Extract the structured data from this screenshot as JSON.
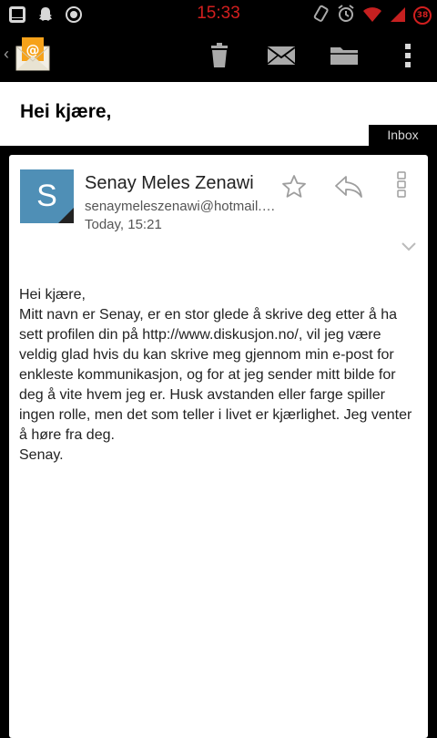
{
  "status_bar": {
    "time": "15:33",
    "battery_level": "38",
    "icons": [
      "gallery-notification-icon",
      "snapchat-icon",
      "sync-icon",
      "rotation-icon",
      "alarm-icon",
      "wifi-icon",
      "signal-icon",
      "battery-icon"
    ],
    "time_color": "#d21f1f"
  },
  "action_bar": {
    "back_glyph": "‹",
    "app_icon": "email-app-icon",
    "actions": [
      "delete-icon",
      "mark-unread-icon",
      "move-folder-icon",
      "overflow-menu-icon"
    ]
  },
  "message": {
    "subject": "Hei kjære,",
    "folder_label": "Inbox",
    "avatar_letter": "S",
    "avatar_color": "#4f8fb6",
    "sender_name": "Senay Meles Zenawi",
    "sender_email": "senaymeleszenawi@hotmail.com",
    "time": "Today, 15:21",
    "body": [
      "Hei kjære,",
      "Mitt navn er Senay, er en stor glede å skrive deg etter å ha sett profilen din på http://www.diskusjon.no/, vil jeg være veldig glad hvis du kan skrive meg gjennom min e-post for enkleste kommunikasjon, og for at jeg sender mitt bilde for deg å vite hvem jeg er. Husk avstanden eller farge spiller ingen rolle, men det som teller i livet er kjærlighet. Jeg venter å høre fra deg.",
      "Senay."
    ]
  }
}
